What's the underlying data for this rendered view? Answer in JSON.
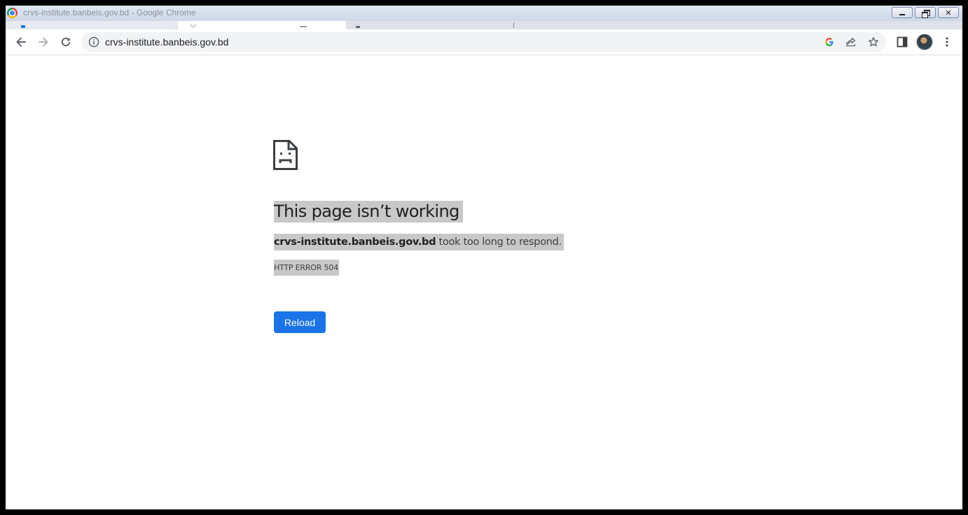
{
  "window": {
    "title": "crvs-institute.banbeis.gov.bd - Google Chrome",
    "minimize_icon": "minimize-icon",
    "maximize_icon": "restore-icon",
    "close_glyph": "✕"
  },
  "toolbar": {
    "url": "crvs-institute.banbeis.gov.bd",
    "icons": [
      "back-arrow-icon",
      "forward-arrow-icon",
      "reload-icon",
      "site-info-icon",
      "google-icon",
      "share-icon",
      "bookmark-star-icon",
      "side-panel-icon",
      "profile-avatar",
      "kebab-menu-icon"
    ]
  },
  "error_page": {
    "icon": "sad-document-icon",
    "title": "This page isn’t working",
    "host": "crvs-institute.banbeis.gov.bd",
    "message": " took too long to respond.",
    "code": "HTTP ERROR 504",
    "reload_label": "Reload"
  },
  "colors": {
    "accent": "#1a73e8",
    "highlight": "#c8c8c8",
    "omnibox": "#f1f3f4"
  }
}
